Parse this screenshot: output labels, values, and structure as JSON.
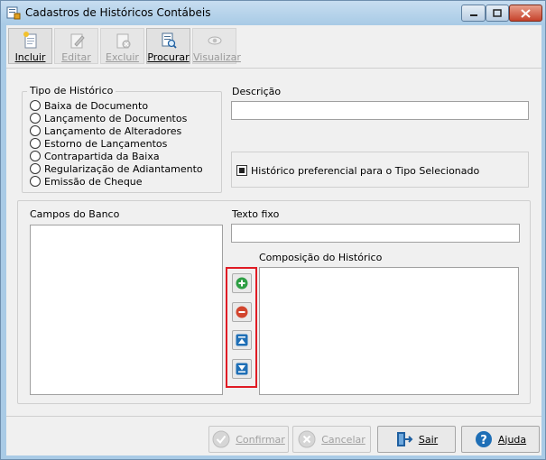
{
  "window": {
    "title": "Cadastros de Históricos Contábeis"
  },
  "toolbar": {
    "items": [
      {
        "label": "Incluir",
        "icon": "new-document-icon",
        "enabled": true
      },
      {
        "label": "Editar",
        "icon": "edit-document-icon",
        "enabled": false
      },
      {
        "label": "Excluir",
        "icon": "delete-document-icon",
        "enabled": false
      },
      {
        "label": "Procurar",
        "icon": "search-document-icon",
        "enabled": true
      },
      {
        "label": "Visualizar",
        "icon": "view-eye-icon",
        "enabled": false
      }
    ]
  },
  "tipo_historico": {
    "title": "Tipo de Histórico",
    "options": [
      "Baixa de Documento",
      "Lançamento de Documentos",
      "Lançamento de Alteradores",
      "Estorno de Lançamentos",
      "Contrapartida da Baixa",
      "Regularização de Adiantamento",
      "Emissão de Cheque"
    ]
  },
  "descricao": {
    "label": "Descrição",
    "value": ""
  },
  "preferencial": {
    "label": "Histórico preferencial para o Tipo Selecionado",
    "checked": true
  },
  "campos_banco": {
    "label": "Campos do Banco",
    "items": []
  },
  "texto_fixo": {
    "label": "Texto fixo",
    "value": ""
  },
  "composicao": {
    "label": "Composição do Histórico",
    "items": []
  },
  "middle_buttons": [
    {
      "icon": "add-icon",
      "color": "#2e9e44"
    },
    {
      "icon": "remove-icon",
      "color": "#d2452e"
    },
    {
      "icon": "move-top-icon",
      "color": "#1f6fb6"
    },
    {
      "icon": "move-bottom-icon",
      "color": "#1f6fb6"
    }
  ],
  "footer": {
    "confirmar": "Confirmar",
    "cancelar": "Cancelar",
    "sair": "Sair",
    "ajuda": "Ajuda"
  },
  "colors": {
    "highlight_frame": "#e01b24",
    "title_bar": "#a9cbe6"
  }
}
